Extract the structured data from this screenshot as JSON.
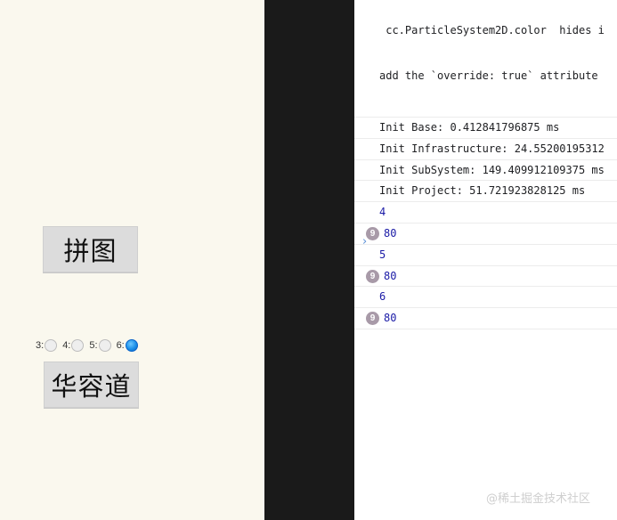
{
  "game": {
    "puzzle_button": "拼图",
    "klotski_button": "华容道",
    "radio_options": [
      {
        "label": "3:",
        "checked": false
      },
      {
        "label": "4:",
        "checked": false
      },
      {
        "label": "5:",
        "checked": false
      },
      {
        "label": "6:",
        "checked": true
      }
    ]
  },
  "console": {
    "warning_line1": " cc.ParticleSystem2D.color  hides i",
    "warning_line2": "add the `override: true` attribute",
    "logs": [
      {
        "text": "Init Base: 0.412841796875 ms",
        "kind": "log"
      },
      {
        "text": "Init Infrastructure: 24.55200195312",
        "kind": "log"
      },
      {
        "text": "Init SubSystem: 149.409912109375 ms",
        "kind": "log"
      },
      {
        "text": "Init Project: 51.721923828125 ms",
        "kind": "log"
      },
      {
        "text": "4",
        "kind": "num"
      },
      {
        "text": "80",
        "kind": "count",
        "count": "9"
      },
      {
        "text": "5",
        "kind": "num"
      },
      {
        "text": "80",
        "kind": "count",
        "count": "9"
      },
      {
        "text": "6",
        "kind": "num"
      },
      {
        "text": "80",
        "kind": "count",
        "count": "9"
      }
    ],
    "prompt_symbol": "›"
  },
  "watermark": "@稀土掘金技术社区"
}
